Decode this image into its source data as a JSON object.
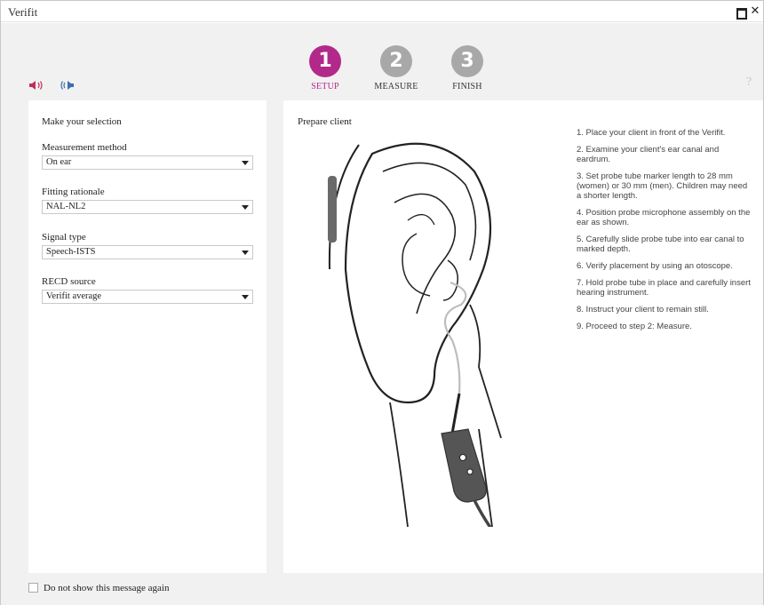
{
  "window": {
    "title": "Verifit"
  },
  "colors": {
    "accent": "#b3298a",
    "step_inactive": "#a8a8a8",
    "speaker_left": "#c0305a",
    "speaker_right": "#3a6fb0"
  },
  "toolbar": {
    "left_speaker_icon": "speaker-left-red-icon",
    "right_speaker_icon": "speaker-right-blue-icon",
    "help_label": "?"
  },
  "steps": [
    {
      "number": "1",
      "label": "SETUP",
      "active": true
    },
    {
      "number": "2",
      "label": "MEASURE",
      "active": false
    },
    {
      "number": "3",
      "label": "FINISH",
      "active": false
    }
  ],
  "selection": {
    "heading": "Make your selection",
    "fields": [
      {
        "label": "Measurement method",
        "value": "On ear"
      },
      {
        "label": "Fitting rationale",
        "value": "NAL-NL2"
      },
      {
        "label": "Signal type",
        "value": "Speech-ISTS"
      },
      {
        "label": "RECD source",
        "value": "Verifit average"
      }
    ]
  },
  "prepare": {
    "title": "Prepare client",
    "illustration": "ear-with-probe-tube-illustration",
    "steps": [
      "1. Place your client in front of the Verifit.",
      "2. Examine your client's ear canal and eardrum.",
      "3. Set probe tube marker length to 28 mm (women) or 30 mm (men). Children may need a shorter length.",
      "4. Position probe microphone assembly on the ear as shown.",
      "5. Carefully slide probe tube into ear canal to marked depth.",
      "6. Verify placement by using an otoscope.",
      "7. Hold probe tube in place and carefully insert hearing instrument.",
      "8. Instruct your client to remain still.",
      "9. Proceed to step 2: Measure."
    ]
  },
  "footer": {
    "checkbox_label": "Do not show this message again",
    "checked": false
  }
}
